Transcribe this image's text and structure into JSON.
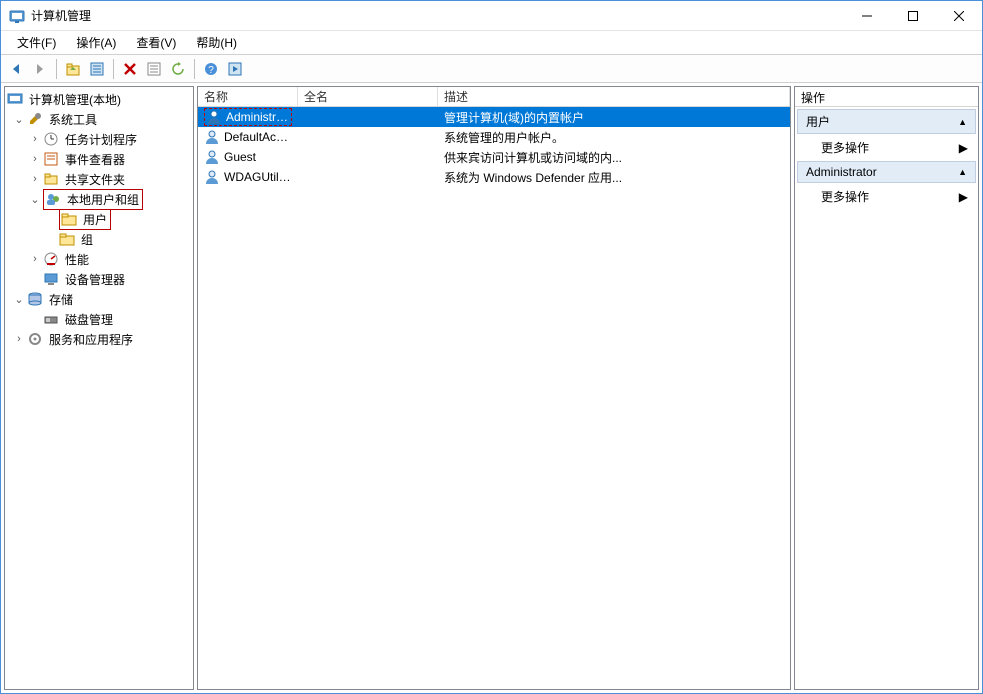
{
  "title": "计算机管理",
  "menus": {
    "file": "文件(F)",
    "action": "操作(A)",
    "view": "查看(V)",
    "help": "帮助(H)"
  },
  "tree": {
    "root": "计算机管理(本地)",
    "system_tools": "系统工具",
    "task_scheduler": "任务计划程序",
    "event_viewer": "事件查看器",
    "shared_folders": "共享文件夹",
    "local_users_groups": "本地用户和组",
    "users": "用户",
    "groups": "组",
    "performance": "性能",
    "device_manager": "设备管理器",
    "storage": "存储",
    "disk_management": "磁盘管理",
    "services_apps": "服务和应用程序"
  },
  "list": {
    "columns": {
      "name": "名称",
      "fullname": "全名",
      "description": "描述"
    },
    "rows": [
      {
        "name": "Administrat...",
        "fullname": "",
        "description": "管理计算机(域)的内置帐户",
        "selected": true
      },
      {
        "name": "DefaultAcc...",
        "fullname": "",
        "description": "系统管理的用户帐户。",
        "selected": false
      },
      {
        "name": "Guest",
        "fullname": "",
        "description": "供来宾访问计算机或访问域的内...",
        "selected": false
      },
      {
        "name": "WDAGUtilit...",
        "fullname": "",
        "description": "系统为 Windows Defender 应用...",
        "selected": false
      }
    ]
  },
  "actions": {
    "header": "操作",
    "section1": "用户",
    "link1": "更多操作",
    "section2": "Administrator",
    "link2": "更多操作"
  }
}
